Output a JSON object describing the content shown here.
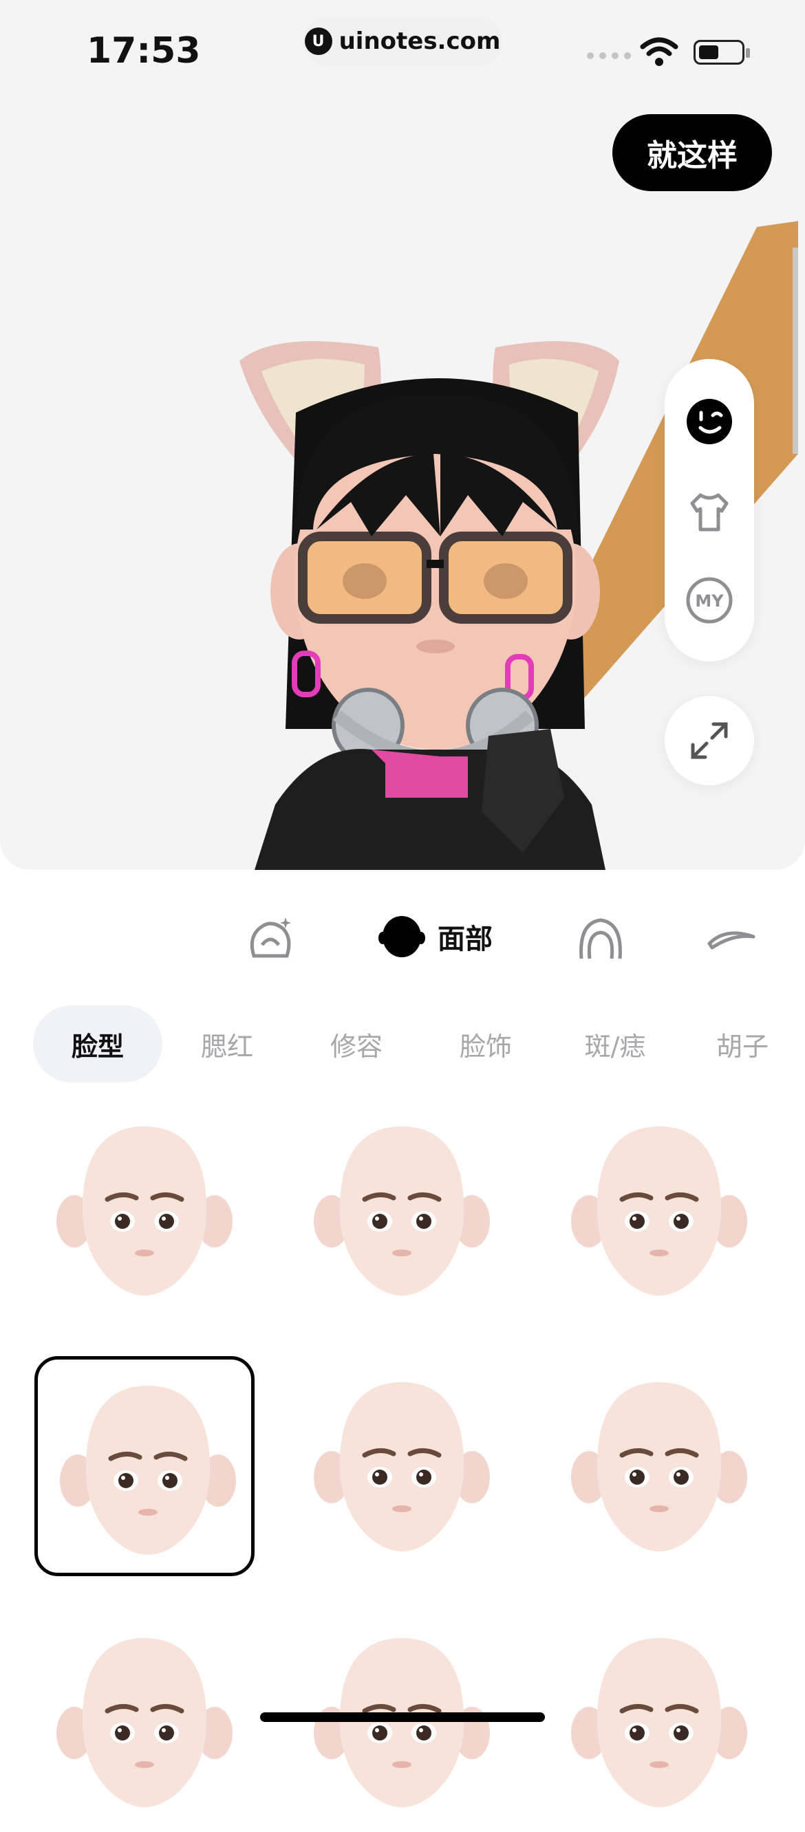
{
  "status": {
    "time": "17:53",
    "site": "uinotes.com"
  },
  "header": {
    "confirm_label": "就这样"
  },
  "side_toolbar": {
    "items": [
      {
        "icon": "face-icon",
        "active": true
      },
      {
        "icon": "shirt-icon",
        "active": false
      },
      {
        "icon": "my-icon",
        "label": "MY",
        "active": false
      }
    ],
    "expand_icon": "expand-icon"
  },
  "category_bar": {
    "items": [
      {
        "icon": "makeup-icon"
      },
      {
        "icon": "face-shape-icon",
        "label": "面部",
        "active": true
      },
      {
        "icon": "hair-icon"
      },
      {
        "icon": "eyebrow-icon"
      }
    ]
  },
  "sub_tabs": {
    "items": [
      {
        "label": "脸型",
        "active": true
      },
      {
        "label": "腮红"
      },
      {
        "label": "修容"
      },
      {
        "label": "脸饰"
      },
      {
        "label": "斑/痣"
      },
      {
        "label": "胡子"
      }
    ]
  },
  "face_options": {
    "selected_index": 3,
    "count": 9
  },
  "colors": {
    "accent": "#000000",
    "background_preview": "#f4f4f5",
    "tab_active_bg": "#f1f2f6",
    "inactive_text": "#a7a7ab"
  }
}
